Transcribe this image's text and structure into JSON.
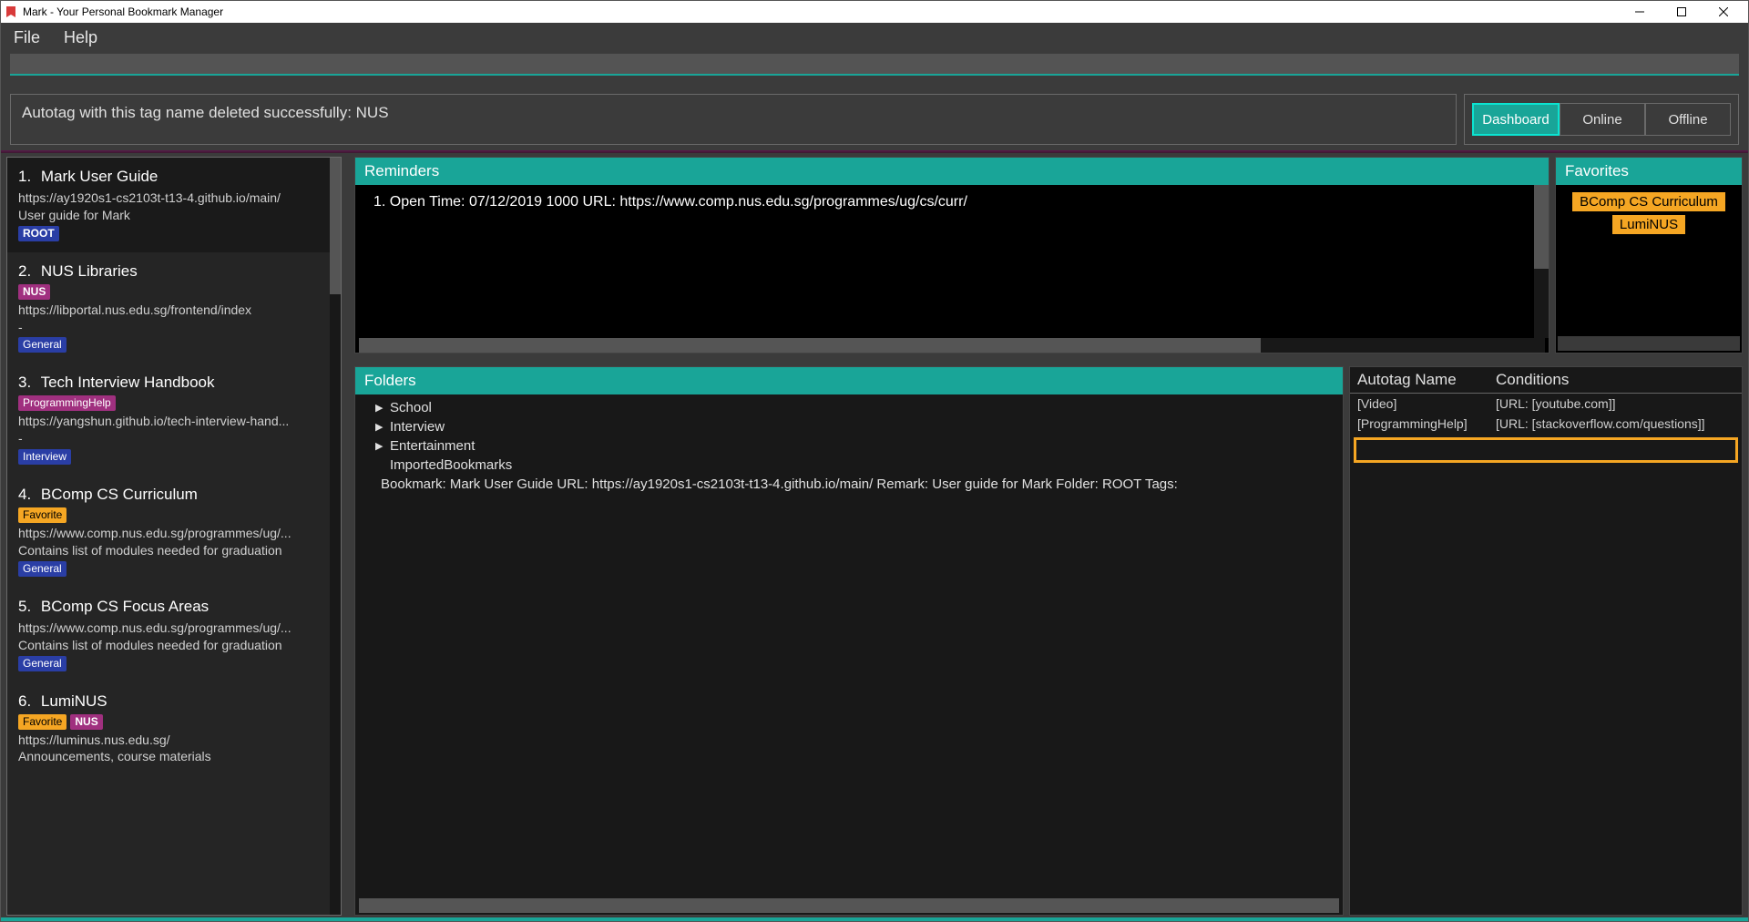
{
  "window": {
    "title": "Mark - Your Personal Bookmark Manager"
  },
  "menu": {
    "file": "File",
    "help": "Help"
  },
  "command_input": {
    "value": "",
    "placeholder": ""
  },
  "status_message": "Autotag with this tag name deleted successfully: NUS",
  "tabs": {
    "dashboard": "Dashboard",
    "online": "Online",
    "offline": "Offline",
    "active": "dashboard"
  },
  "sidebar": {
    "items": [
      {
        "num": "1.",
        "title": "Mark User Guide",
        "url": "https://ay1920s1-cs2103t-t13-4.github.io/main/",
        "desc": "User guide for Mark",
        "tags": [
          [
            "ROOT",
            "root"
          ]
        ],
        "selected": true
      },
      {
        "num": "2.",
        "title": "NUS Libraries",
        "pre_tags": [
          [
            "NUS",
            "nus"
          ]
        ],
        "url": "https://libportal.nus.edu.sg/frontend/index",
        "desc": "-",
        "tags": [
          [
            "General",
            "general"
          ]
        ]
      },
      {
        "num": "3.",
        "title": "Tech Interview Handbook",
        "pre_tags": [
          [
            "ProgrammingHelp",
            "programming"
          ]
        ],
        "url": "https://yangshun.github.io/tech-interview-hand...",
        "desc": "-",
        "tags": [
          [
            "Interview",
            "interview"
          ]
        ]
      },
      {
        "num": "4.",
        "title": "BComp CS Curriculum",
        "pre_tags": [
          [
            "Favorite",
            "favorite"
          ]
        ],
        "url": "https://www.comp.nus.edu.sg/programmes/ug/...",
        "desc": "Contains list of modules needed for graduation",
        "tags": [
          [
            "General",
            "general"
          ]
        ]
      },
      {
        "num": "5.",
        "title": "BComp CS Focus Areas",
        "url": "https://www.comp.nus.edu.sg/programmes/ug/...",
        "desc": "Contains list of modules needed for graduation",
        "tags": [
          [
            "General",
            "general"
          ]
        ]
      },
      {
        "num": "6.",
        "title": "LumiNUS",
        "pre_tags": [
          [
            "Favorite",
            "favorite"
          ],
          [
            "NUS",
            "nus"
          ]
        ],
        "url": "https://luminus.nus.edu.sg/",
        "desc": "Announcements, course materials"
      }
    ]
  },
  "reminders": {
    "header": "Reminders",
    "items": [
      "1. Open Time: 07/12/2019 1000 URL: https://www.comp.nus.edu.sg/programmes/ug/cs/curr/"
    ]
  },
  "favorites": {
    "header": "Favorites",
    "items": [
      "BComp CS Curriculum",
      "LumiNUS"
    ]
  },
  "folders": {
    "header": "Folders",
    "tree": [
      {
        "label": "School",
        "expandable": true
      },
      {
        "label": "Interview",
        "expandable": true
      },
      {
        "label": "Entertainment",
        "expandable": true
      },
      {
        "label": "ImportedBookmarks",
        "expandable": false
      }
    ],
    "detail_line": "Bookmark: Mark User Guide URL: https://ay1920s1-cs2103t-t13-4.github.io/main/ Remark: User guide for Mark Folder: ROOT Tags:"
  },
  "autotag": {
    "col_name": "Autotag Name",
    "col_cond": "Conditions",
    "rows": [
      {
        "name": "[Video]",
        "cond": "[URL: [youtube.com]]"
      },
      {
        "name": "[ProgrammingHelp]",
        "cond": "[URL: [stackoverflow.com/questions]]"
      }
    ]
  }
}
